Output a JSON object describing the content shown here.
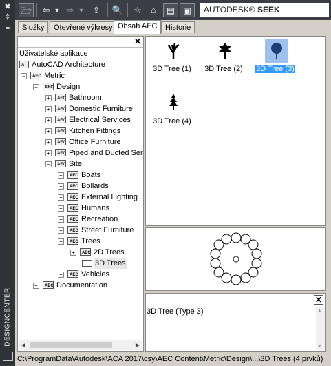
{
  "window": {
    "title": "DESIGNCENTER"
  },
  "toolbar": {
    "seek_brand": "AUTODESK®",
    "seek_name": "SEEK"
  },
  "tabs": [
    {
      "label": "Složky"
    },
    {
      "label": "Otevřené výkresy"
    },
    {
      "label": "Obsah AEC"
    },
    {
      "label": "Historie"
    }
  ],
  "active_tab": "Obsah AEC",
  "tree": {
    "nodes": [
      {
        "label": "Uživatelské aplikace"
      },
      {
        "label": "AutoCAD Architecture"
      },
      {
        "label": "Metric"
      },
      {
        "label": "Design"
      },
      {
        "label": "Bathroom"
      },
      {
        "label": "Domestic Furniture"
      },
      {
        "label": "Electrical Services"
      },
      {
        "label": "Kitchen Fittings"
      },
      {
        "label": "Office Furniture"
      },
      {
        "label": "Piped and Ducted Ser"
      },
      {
        "label": "Site"
      },
      {
        "label": "Boats"
      },
      {
        "label": "Bollards"
      },
      {
        "label": "External Lighting"
      },
      {
        "label": "Humans"
      },
      {
        "label": "Recreation"
      },
      {
        "label": "Street Furniture"
      },
      {
        "label": "Trees"
      },
      {
        "label": "2D Trees"
      },
      {
        "label": "3D Trees"
      },
      {
        "label": "Vehicles"
      },
      {
        "label": "Documentation"
      }
    ],
    "selected": "3D Trees"
  },
  "items": [
    {
      "label": "3D Tree (1)"
    },
    {
      "label": "3D Tree (2)"
    },
    {
      "label": "3D Tree (3)"
    },
    {
      "label": "3D Tree (4)"
    }
  ],
  "selected_item": "3D Tree (3)",
  "description": {
    "text": "3D Tree (Type 3)"
  },
  "status": {
    "path": "C:\\ProgramData\\Autodesk\\ACA 2017\\csy\\AEC Content\\Metric\\Design\\...\\3D Trees (4 prvků)"
  },
  "colors": {
    "selection": "#3399ff",
    "selection_thumb": "#9dc1ec",
    "toolbar": "#3b3f45",
    "sidebar": "#2f3237"
  },
  "icons": [
    "folder-open-icon",
    "back-icon",
    "forward-icon",
    "up-icon",
    "search-icon",
    "favorites-icon",
    "home-icon",
    "tree-toggle-icon",
    "preview-icon",
    "close-icon",
    "pin-icon",
    "properties-icon",
    "aec-folder-icon",
    "tree-icon"
  ]
}
